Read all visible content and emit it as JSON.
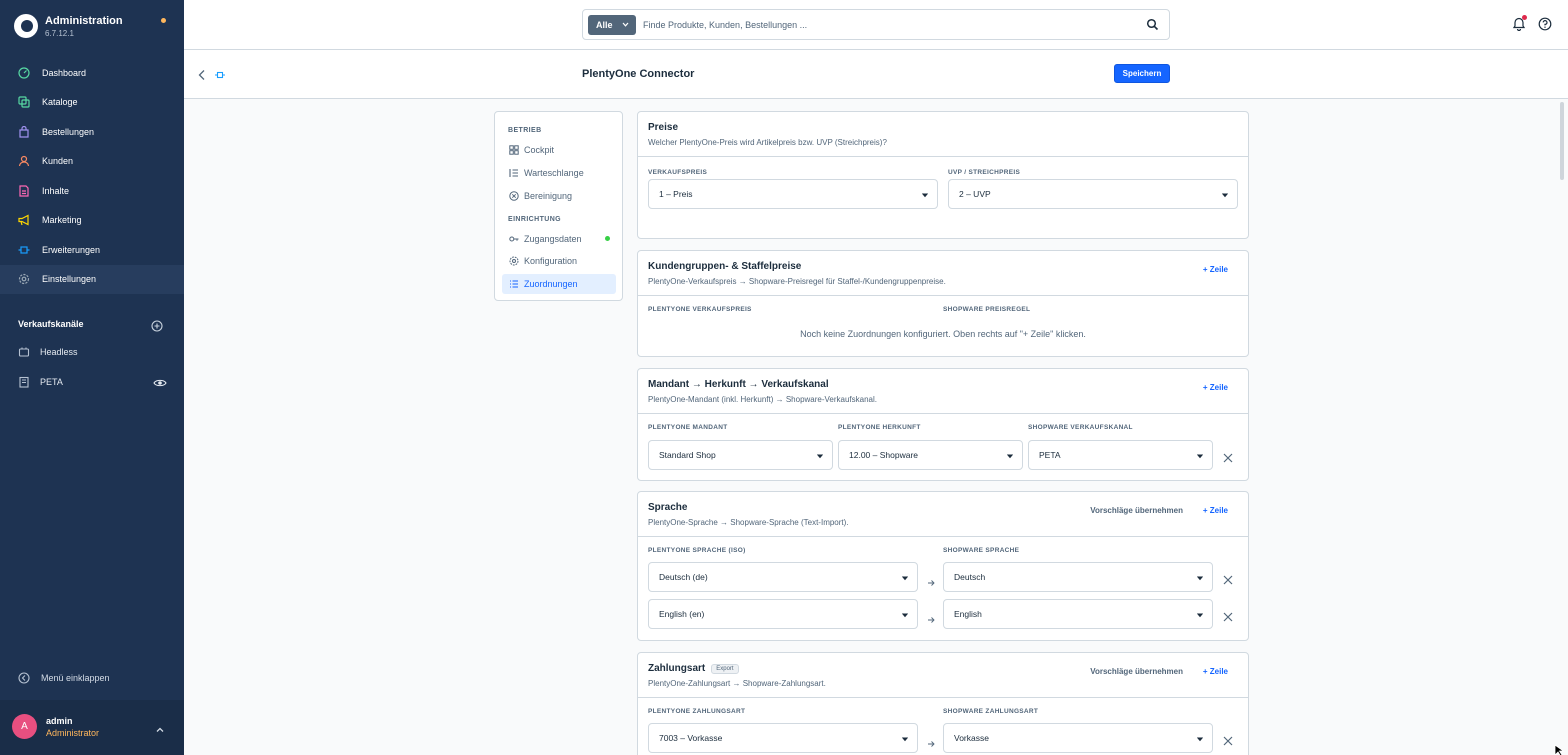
{
  "app": {
    "title": "Administration",
    "version": "6.7.12.1"
  },
  "sidebar": {
    "items": [
      {
        "label": "Dashboard",
        "icon": "dashboard-icon",
        "color": "#57d9a3"
      },
      {
        "label": "Kataloge",
        "icon": "catalog-icon",
        "color": "#57d9a3"
      },
      {
        "label": "Bestellungen",
        "icon": "orders-icon",
        "color": "#a092f0"
      },
      {
        "label": "Kunden",
        "icon": "customers-icon",
        "color": "#f88962"
      },
      {
        "label": "Inhalte",
        "icon": "content-icon",
        "color": "#ff68b4"
      },
      {
        "label": "Marketing",
        "icon": "marketing-icon",
        "color": "#ffd700"
      },
      {
        "label": "Erweiterungen",
        "icon": "extensions-icon",
        "color": "#189eff"
      },
      {
        "label": "Einstellungen",
        "icon": "settings-icon",
        "color": "#9aa8b5"
      }
    ],
    "sales_channels_title": "Verkaufskanäle",
    "sales_channels": [
      {
        "label": "Headless",
        "icon": "headless-icon"
      },
      {
        "label": "PETA",
        "icon": "storefront-icon"
      }
    ],
    "collapse_label": "Menü einklappen",
    "user": {
      "initial": "A",
      "name": "admin",
      "role": "Administrator"
    }
  },
  "search": {
    "type_label": "Alle",
    "placeholder": "Finde Produkte, Kunden, Bestellungen ..."
  },
  "page": {
    "title": "PlentyOne Connector",
    "save_label": "Speichern"
  },
  "plugin_nav": {
    "section_operation": "BETRIEB",
    "operation_items": [
      "Cockpit",
      "Warteschlange",
      "Bereinigung"
    ],
    "section_setup": "EINRICHTUNG",
    "setup_items": [
      "Zugangsdaten",
      "Konfiguration",
      "Zuordnungen"
    ]
  },
  "common": {
    "add_row": "+ Zeile",
    "apply_suggestions": "Vorschläge übernehmen"
  },
  "prices": {
    "title": "Preise",
    "subtitle": "Welcher PlentyOne-Preis wird Artikelpreis bzw. UVP (Streichpreis)?",
    "sale_label": "VERKAUFSPREIS",
    "sale_value": "1 – Preis",
    "rrp_label": "UVP / STREICHPREIS",
    "rrp_value": "2 – UVP"
  },
  "customer_groups": {
    "title": "Kundengruppen- & Staffelpreise",
    "subtitle": "PlentyOne-Verkaufspreis → Shopware-Preisregel für Staffel-/Kundengruppenpreise.",
    "col1": "PLENTYONE VERKAUFSPREIS",
    "col2": "SHOPWARE PREISREGEL",
    "empty": "Noch keine Zuordnungen konfiguriert. Oben rechts auf \"+ Zeile\" klicken."
  },
  "client": {
    "title": "Mandant → Herkunft → Verkaufskanal",
    "subtitle": "PlentyOne-Mandant (inkl. Herkunft) → Shopware-Verkaufskanal.",
    "col1": "PLENTYONE MANDANT",
    "col2": "PLENTYONE HERKUNFT",
    "col3": "SHOPWARE VERKAUFSKANAL",
    "row": {
      "client": "Standard Shop",
      "origin": "12.00 – Shopware",
      "channel": "PETA"
    }
  },
  "language": {
    "title": "Sprache",
    "subtitle": "PlentyOne-Sprache → Shopware-Sprache (Text-Import).",
    "col1": "PLENTYONE SPRACHE (ISO)",
    "col2": "SHOPWARE SPRACHE",
    "rows": [
      {
        "plenty": "Deutsch (de)",
        "shopware": "Deutsch"
      },
      {
        "plenty": "English (en)",
        "shopware": "English"
      }
    ]
  },
  "payment": {
    "title": "Zahlungsart",
    "badge": "Export",
    "subtitle": "PlentyOne-Zahlungsart → Shopware-Zahlungsart.",
    "col1": "PLENTYONE ZAHLUNGSART",
    "col2": "SHOPWARE ZAHLUNGSART",
    "row": {
      "plenty": "7003 – Vorkasse",
      "shopware": "Vorkasse"
    }
  },
  "colors": {
    "sidebar": "#1e3352",
    "accent": "#1565ff",
    "warning": "#ffb75d",
    "success": "#37d046"
  }
}
